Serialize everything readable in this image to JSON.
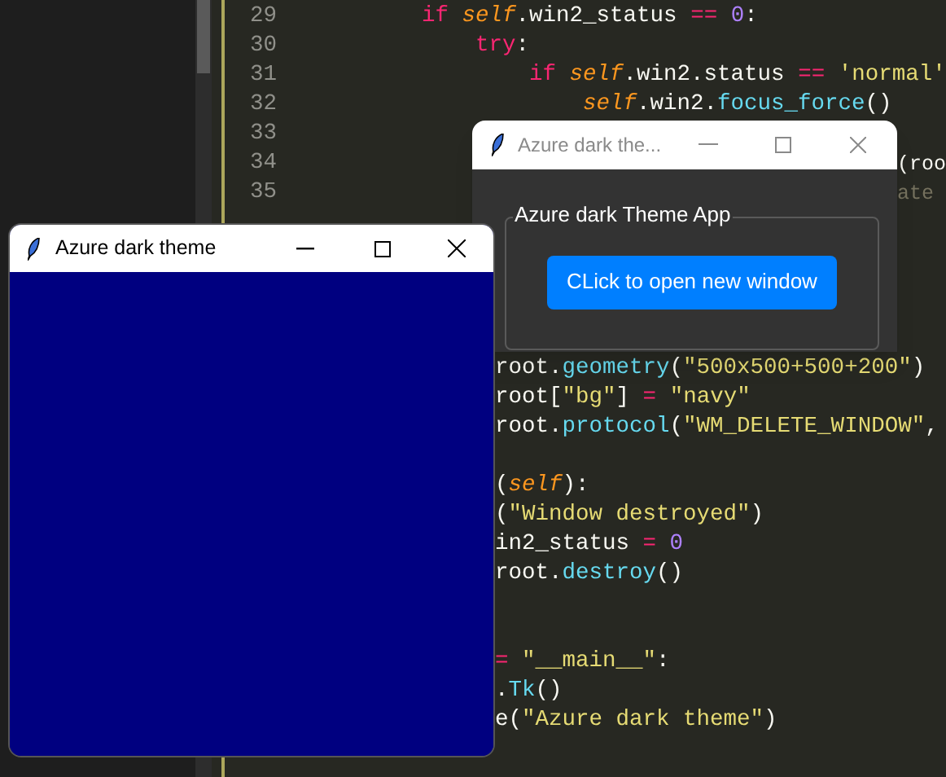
{
  "editor": {
    "lines": [
      {
        "kind": "code",
        "number": "29",
        "segments": [
          {
            "kind": "indent2",
            "tokens": [
              {
                "text": "if ",
                "color": "#f92672"
              },
              {
                "text": "self",
                "color": "#fd971f",
                "italic": true
              },
              {
                "text": ".win2_status ",
                "color": "#f8f8f2"
              },
              {
                "text": "== ",
                "color": "#f92672"
              },
              {
                "text": "0",
                "color": "#ae81ff"
              },
              {
                "text": ":",
                "color": "#f8f8f2"
              }
            ]
          }
        ]
      },
      {
        "kind": "code",
        "number": "30",
        "segments": [
          {
            "kind": "indent3",
            "tokens": [
              {
                "text": "try",
                "color": "#f92672"
              },
              {
                "text": ":",
                "color": "#f8f8f2"
              }
            ]
          }
        ]
      },
      {
        "kind": "code",
        "number": "31",
        "segments": [
          {
            "kind": "indent4",
            "tokens": [
              {
                "text": "if ",
                "color": "#f92672"
              },
              {
                "text": "self",
                "color": "#fd971f",
                "italic": true
              },
              {
                "text": ".win2.status ",
                "color": "#f8f8f2"
              },
              {
                "text": "== ",
                "color": "#f92672"
              },
              {
                "text": "'normal'",
                "color": "#e6db74"
              }
            ]
          }
        ]
      },
      {
        "kind": "code",
        "number": "32",
        "segments": [
          {
            "kind": "indent5",
            "tokens": [
              {
                "text": "self",
                "color": "#fd971f",
                "italic": true
              },
              {
                "text": ".win2.",
                "color": "#f8f8f2"
              },
              {
                "text": "focus_force",
                "color": "#66d9ef"
              },
              {
                "text": "()",
                "color": "#f8f8f2"
              }
            ]
          }
        ]
      },
      {
        "kind": "code",
        "number": "33"
      },
      {
        "kind": "code",
        "number": "34",
        "segments": [
          {
            "kind": "right_of_dialog",
            "tokens": [
              {
                "text": "(roo",
                "color": "#f8f8f2"
              }
            ]
          }
        ]
      },
      {
        "kind": "code",
        "number": "35",
        "segments": [
          {
            "kind": "right_of_dialog",
            "tokens": [
              {
                "text": "ate",
                "color": "#75715e"
              }
            ]
          }
        ]
      },
      {
        "kind": "blank"
      },
      {
        "kind": "blank"
      },
      {
        "kind": "blank"
      },
      {
        "kind": "blank"
      },
      {
        "kind": "blank"
      },
      {
        "kind": "code",
        "segments": [
          {
            "kind": "right_of_window",
            "tokens": [
              {
                "text": "root.",
                "color": "#f8f8f2"
              },
              {
                "text": "geometry",
                "color": "#66d9ef"
              },
              {
                "text": "(",
                "color": "#f8f8f2"
              },
              {
                "text": "\"500x500+500+200\"",
                "color": "#e6db74"
              },
              {
                "text": ")",
                "color": "#f8f8f2"
              }
            ]
          }
        ]
      },
      {
        "kind": "code",
        "segments": [
          {
            "kind": "right_of_window",
            "tokens": [
              {
                "text": "root[",
                "color": "#f8f8f2"
              },
              {
                "text": "\"bg\"",
                "color": "#e6db74"
              },
              {
                "text": "] ",
                "color": "#f8f8f2"
              },
              {
                "text": "= ",
                "color": "#f92672"
              },
              {
                "text": "\"navy\"",
                "color": "#e6db74"
              }
            ]
          }
        ]
      },
      {
        "kind": "code",
        "segments": [
          {
            "kind": "right_of_window",
            "tokens": [
              {
                "text": "root.",
                "color": "#f8f8f2"
              },
              {
                "text": "protocol",
                "color": "#66d9ef"
              },
              {
                "text": "(",
                "color": "#f8f8f2"
              },
              {
                "text": "\"WM_DELETE_WINDOW\"",
                "color": "#e6db74"
              },
              {
                "text": ",",
                "color": "#f8f8f2"
              }
            ]
          }
        ]
      },
      {
        "kind": "blank"
      },
      {
        "kind": "code",
        "segments": [
          {
            "kind": "right_of_window",
            "tokens": [
              {
                "text": "(",
                "color": "#f8f8f2"
              },
              {
                "text": "self",
                "color": "#fd971f",
                "italic": true
              },
              {
                "text": "):",
                "color": "#f8f8f2"
              }
            ]
          }
        ]
      },
      {
        "kind": "code",
        "segments": [
          {
            "kind": "right_of_window",
            "tokens": [
              {
                "text": "(",
                "color": "#f8f8f2"
              },
              {
                "text": "\"Window destroyed\"",
                "color": "#e6db74"
              },
              {
                "text": ")",
                "color": "#f8f8f2"
              }
            ]
          }
        ]
      },
      {
        "kind": "code",
        "segments": [
          {
            "kind": "right_of_window",
            "tokens": [
              {
                "text": "in2_status ",
                "color": "#f8f8f2"
              },
              {
                "text": "= ",
                "color": "#f92672"
              },
              {
                "text": "0",
                "color": "#ae81ff"
              }
            ]
          }
        ]
      },
      {
        "kind": "code",
        "segments": [
          {
            "kind": "right_of_window",
            "tokens": [
              {
                "text": "root.",
                "color": "#f8f8f2"
              },
              {
                "text": "destroy",
                "color": "#66d9ef"
              },
              {
                "text": "()",
                "color": "#f8f8f2"
              }
            ]
          }
        ]
      },
      {
        "kind": "blank"
      },
      {
        "kind": "blank"
      },
      {
        "kind": "code",
        "segments": [
          {
            "kind": "right_of_window",
            "tokens": [
              {
                "text": "= ",
                "color": "#f92672"
              },
              {
                "text": "\"__main__\"",
                "color": "#e6db74"
              },
              {
                "text": ":",
                "color": "#f8f8f2"
              }
            ]
          }
        ]
      },
      {
        "kind": "code",
        "segments": [
          {
            "kind": "right_of_window",
            "tokens": [
              {
                "text": ".",
                "color": "#f8f8f2"
              },
              {
                "text": "Tk",
                "color": "#66d9ef"
              },
              {
                "text": "()",
                "color": "#f8f8f2"
              }
            ]
          }
        ]
      },
      {
        "kind": "code",
        "segments": [
          {
            "kind": "right_of_window",
            "tokens": [
              {
                "text": "e(",
                "color": "#f8f8f2"
              },
              {
                "text": "\"Azure dark theme\"",
                "color": "#e6db74"
              },
              {
                "text": ")",
                "color": "#f8f8f2"
              }
            ]
          }
        ]
      }
    ]
  },
  "dialog": {
    "title": "Azure dark the...",
    "active": false,
    "frame_label": "Azure dark Theme App",
    "button": "CLick to open new window"
  },
  "main_window": {
    "title": "Azure dark theme",
    "active": true
  }
}
